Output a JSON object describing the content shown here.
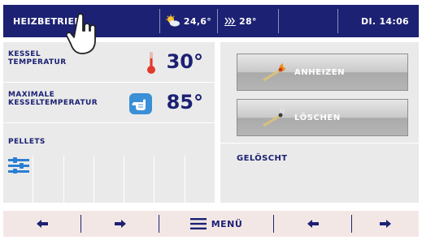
{
  "topbar": {
    "mode": "HEIZBETRIEB",
    "outdoor_temp": "24,6°",
    "room_temp": "28°",
    "datetime": "DI. 14:06",
    "icons": {
      "weather": "sun-cloud-icon",
      "heater": "radiator-icon"
    }
  },
  "left": {
    "kessel_label_1": "KESSEL",
    "kessel_label_2": "TEMPERATUR",
    "kessel_value": "30°",
    "max_label_1": "MAXIMALE",
    "max_label_2": "KESSELTEMPERATUR",
    "max_value": "85°",
    "pellets_label": "PELLETS"
  },
  "right": {
    "btn_start": "ANHEIZEN",
    "btn_stop": "LÖSCHEN",
    "status": "GELÖSCHT"
  },
  "bottom": {
    "menu_label": "MENÜ"
  },
  "colors": {
    "navy": "#1c2173",
    "panel": "#eaeaea",
    "bottom": "#f3e7e6",
    "thermometer": "#e23a2a",
    "accent_blue": "#3a8fd6"
  }
}
